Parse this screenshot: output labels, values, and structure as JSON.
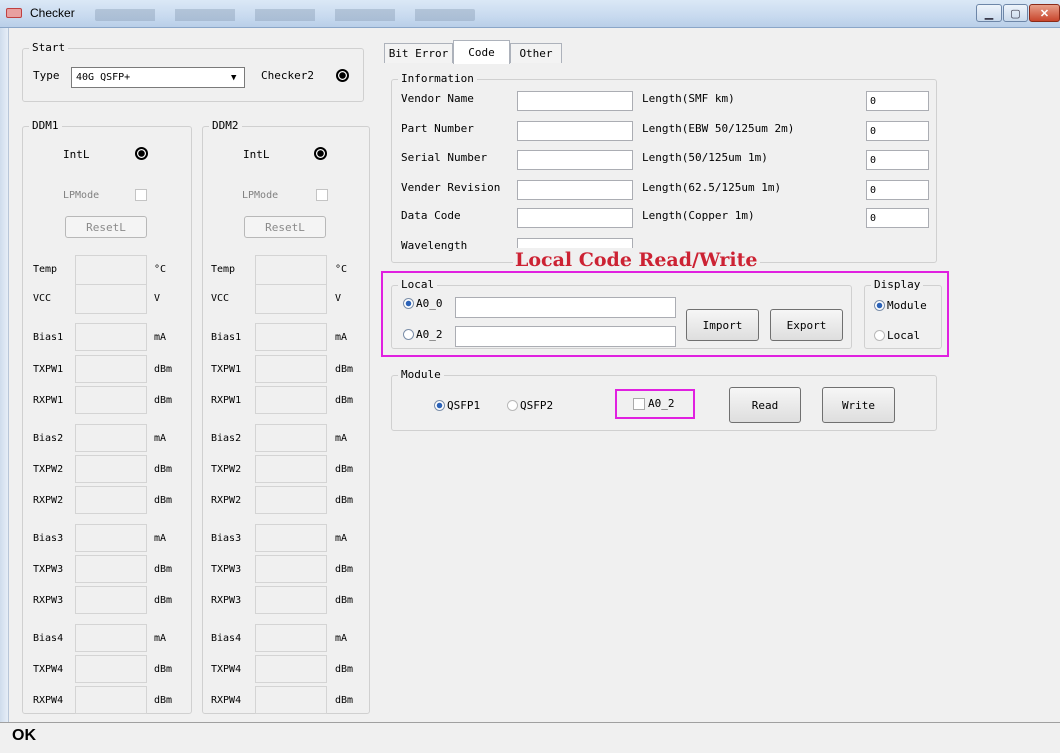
{
  "window": {
    "title": "Checker",
    "status": "OK"
  },
  "start": {
    "legend": "Start",
    "type_label": "Type",
    "type_value": "40G QSFP+",
    "checker_label": "Checker2"
  },
  "ddm": [
    {
      "legend": "DDM1",
      "intl": "IntL",
      "lpmode": "LPMode",
      "reset": "ResetL",
      "rows": [
        {
          "label": "Temp",
          "unit": "°C"
        },
        {
          "label": "VCC",
          "unit": "V"
        },
        {
          "label": "Bias1",
          "unit": "mA"
        },
        {
          "label": "TXPW1",
          "unit": "dBm"
        },
        {
          "label": "RXPW1",
          "unit": "dBm"
        },
        {
          "label": "Bias2",
          "unit": "mA"
        },
        {
          "label": "TXPW2",
          "unit": "dBm"
        },
        {
          "label": "RXPW2",
          "unit": "dBm"
        },
        {
          "label": "Bias3",
          "unit": "mA"
        },
        {
          "label": "TXPW3",
          "unit": "dBm"
        },
        {
          "label": "RXPW3",
          "unit": "dBm"
        },
        {
          "label": "Bias4",
          "unit": "mA"
        },
        {
          "label": "TXPW4",
          "unit": "dBm"
        },
        {
          "label": "RXPW4",
          "unit": "dBm"
        }
      ]
    },
    {
      "legend": "DDM2",
      "intl": "IntL",
      "lpmode": "LPMode",
      "reset": "ResetL",
      "rows": [
        {
          "label": "Temp",
          "unit": "°C"
        },
        {
          "label": "VCC",
          "unit": "V"
        },
        {
          "label": "Bias1",
          "unit": "mA"
        },
        {
          "label": "TXPW1",
          "unit": "dBm"
        },
        {
          "label": "RXPW1",
          "unit": "dBm"
        },
        {
          "label": "Bias2",
          "unit": "mA"
        },
        {
          "label": "TXPW2",
          "unit": "dBm"
        },
        {
          "label": "RXPW2",
          "unit": "dBm"
        },
        {
          "label": "Bias3",
          "unit": "mA"
        },
        {
          "label": "TXPW3",
          "unit": "dBm"
        },
        {
          "label": "RXPW3",
          "unit": "dBm"
        },
        {
          "label": "Bias4",
          "unit": "mA"
        },
        {
          "label": "TXPW4",
          "unit": "dBm"
        },
        {
          "label": "RXPW4",
          "unit": "dBm"
        }
      ]
    }
  ],
  "tabs": [
    "Bit Error",
    "Code",
    "Other"
  ],
  "info": {
    "legend": "Information",
    "left": [
      "Vendor Name",
      "Part Number",
      "Serial Number",
      "Vender Revision",
      "Data Code",
      "Wavelength"
    ],
    "right": [
      {
        "label": "Length(SMF km)",
        "value": "0"
      },
      {
        "label": "Length(EBW 50/125um 2m)",
        "value": "0"
      },
      {
        "label": "Length(50/125um 1m)",
        "value": "0"
      },
      {
        "label": "Length(62.5/125um 1m)",
        "value": "0"
      },
      {
        "label": "Length(Copper 1m)",
        "value": "0"
      }
    ]
  },
  "annotation": "Local Code Read/Write",
  "local": {
    "legend": "Local",
    "a0_0": "A0_0",
    "a0_2": "A0_2",
    "import": "Import",
    "export": "Export"
  },
  "display": {
    "legend": "Display",
    "module": "Module",
    "local": "Local"
  },
  "module": {
    "legend": "Module",
    "qsfp1": "QSFP1",
    "qsfp2": "QSFP2",
    "a0_2": "A0_2",
    "read": "Read",
    "write": "Write"
  },
  "colors": {
    "highlight": "#e020e0",
    "annotation": "#cc2233"
  }
}
